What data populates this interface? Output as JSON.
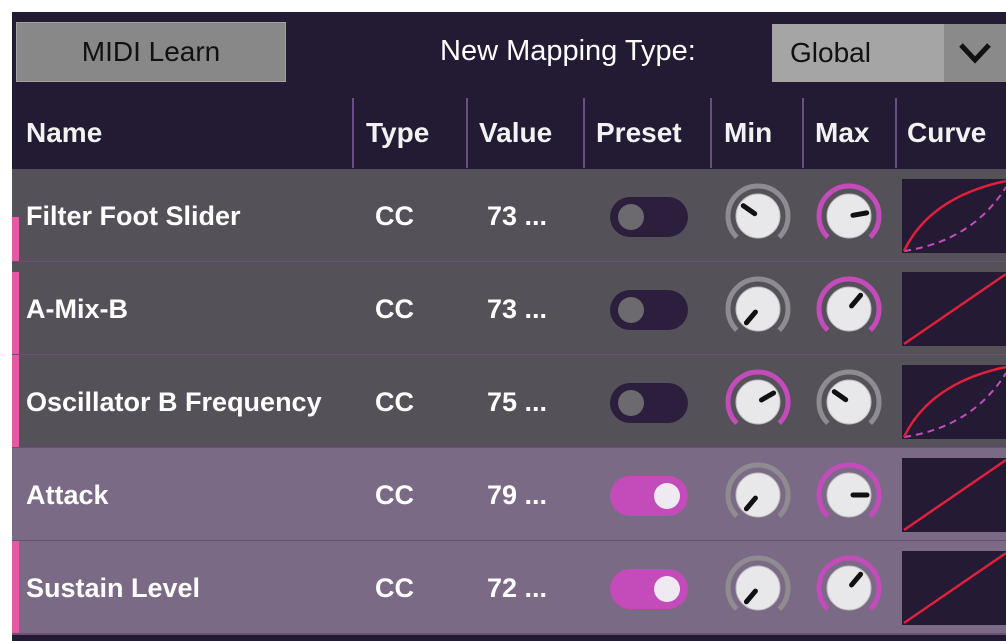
{
  "toolbar": {
    "midi_learn_label": "MIDI Learn",
    "mapping_type_label": "New Mapping Type:",
    "mapping_type_value": "Global"
  },
  "columns": [
    "Name",
    "Type",
    "Value",
    "Preset",
    "Min",
    "Max",
    "Curve"
  ],
  "colors": {
    "accent": "#c34bba",
    "curve_line": "#e0203c",
    "panel_bg": "#231a33"
  },
  "rows": [
    {
      "name": "Filter Foot Slider",
      "type": "CC",
      "value": "73 ...",
      "preset_on": false,
      "min_active": false,
      "max_active": true,
      "curve_style": "dashed"
    },
    {
      "name": "A-Mix-B",
      "type": "CC",
      "value": "73 ...",
      "preset_on": false,
      "min_active": false,
      "max_active": true,
      "curve_style": "linear"
    },
    {
      "name": "Oscillator B Frequency",
      "type": "CC",
      "value": "75 ...",
      "preset_on": false,
      "min_active": true,
      "max_active": false,
      "curve_style": "dashed"
    },
    {
      "name": "Attack",
      "type": "CC",
      "value": "79 ...",
      "preset_on": true,
      "min_active": false,
      "max_active": true,
      "curve_style": "linear"
    },
    {
      "name": "Sustain Level",
      "type": "CC",
      "value": "72 ...",
      "preset_on": true,
      "min_active": false,
      "max_active": true,
      "curve_style": "linear"
    }
  ]
}
